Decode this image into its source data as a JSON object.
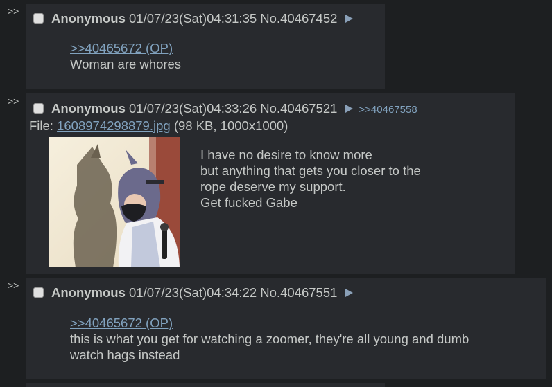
{
  "posts": [
    {
      "arrows": ">>",
      "name": "Anonymous",
      "datetime": "01/07/23(Sat)04:31:35",
      "post_number": "No.40467452",
      "quote": ">>40465672 (OP)",
      "lines": [
        "Woman are whores"
      ]
    },
    {
      "arrows": ">>",
      "name": "Anonymous",
      "datetime": "01/07/23(Sat)04:33:26",
      "post_number": "No.40467521",
      "backlink": ">>40467558",
      "file_label": "File:",
      "file_name": "1608974298879.jpg",
      "file_info": "(98 KB, 1000x1000)",
      "lines": [
        "I have no desire to know more",
        "but anything that gets you closer to the",
        "rope deserve my support.",
        "Get fucked Gabe"
      ]
    },
    {
      "arrows": ">>",
      "name": "Anonymous",
      "datetime": "01/07/23(Sat)04:34:22",
      "post_number": "No.40467551",
      "quote": ">>40465672 (OP)",
      "lines": [
        "this is what you get for watching a zoomer, they're all young and dumb",
        "watch hags instead"
      ]
    }
  ],
  "colors": {
    "page_bg": "#1d1f21",
    "post_bg": "#282a2e",
    "text": "#c5c8c6",
    "link": "#81a2be"
  }
}
